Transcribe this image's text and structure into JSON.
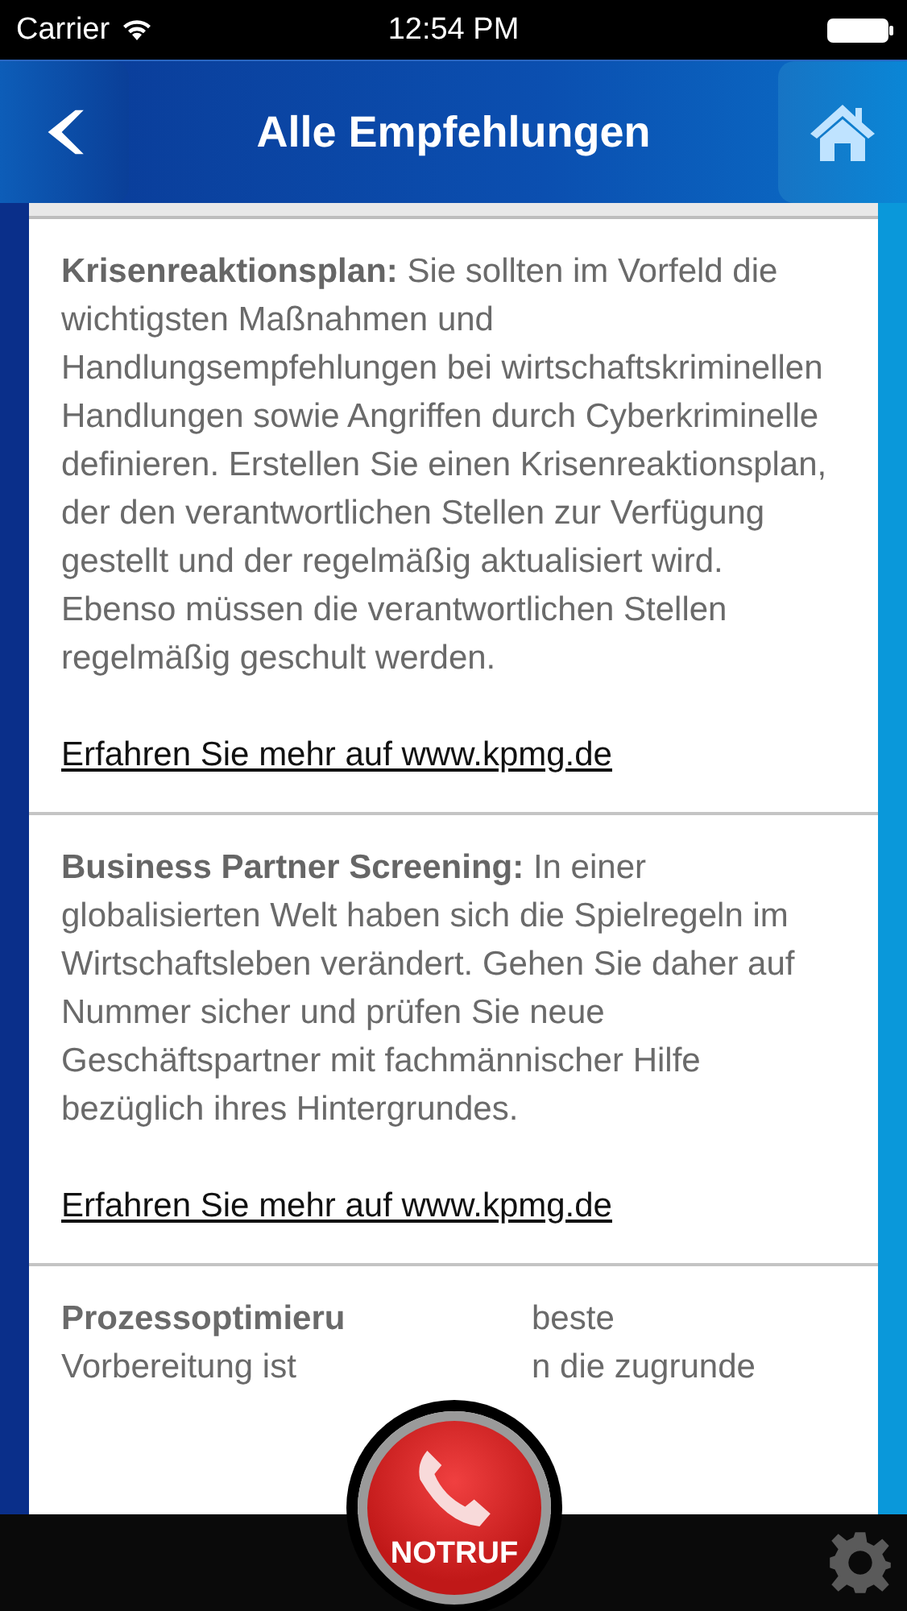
{
  "status_bar": {
    "carrier": "Carrier",
    "time": "12:54 PM"
  },
  "nav": {
    "title": "Alle Empfehlungen"
  },
  "cards": [
    {
      "text": "**Krisenreaktionsplan:** Sie sollten im Vorfeld die wichtigsten Maßnahmen und Handlungsempfehlungen bei wirtschaftskriminellen Handlungen sowie Angriffen durch Cyberkriminelle definieren. Erstellen Sie einen Krisenreaktionsplan, der den verantwortlichen Stellen zur Verfügung gestellt und der regelmäßig aktualisiert wird. Ebenso müssen die verantwortlichen Stellen regelmäßig geschult werden.",
      "link": "Erfahren Sie mehr auf www.kpmg.de"
    },
    {
      "text": "**Business Partner Screening:** In einer globalisierten Welt haben sich die Spielregeln im Wirtschaftsleben verändert. Gehen Sie daher auf Nummer sicher und prüfen Sie neue Geschäftspartner mit fachmännischer Hilfe bezüglich ihres Hintergrundes.",
      "link": "Erfahren Sie mehr auf www.kpmg.de"
    }
  ],
  "partial_card": {
    "lines": [
      {
        "kind": "heading",
        "left": "Prozessoptimieru",
        "right": "beste"
      },
      {
        "kind": "text",
        "left": "Vorbereitung ist",
        "right": "n die zugrunde"
      }
    ]
  },
  "emergency_button": {
    "label": "NOTRUF"
  }
}
